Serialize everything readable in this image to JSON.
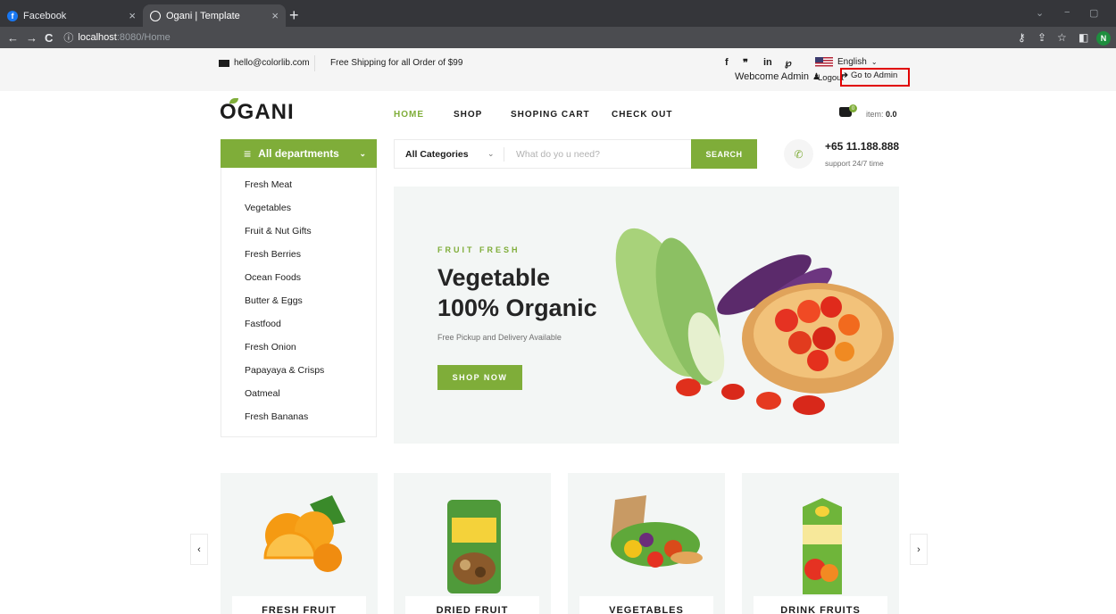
{
  "browser": {
    "tabs": [
      {
        "title": "Facebook",
        "favicon": "facebook-icon",
        "active": false
      },
      {
        "title": "Ogani | Template",
        "favicon": "globe-icon",
        "active": true
      }
    ],
    "url_host": "localhost",
    "url_path": ":8080/Home",
    "profile_initial": "N"
  },
  "topbar": {
    "email": "hello@colorlib.com",
    "shipping": "Free Shipping for all Order of $99",
    "social": [
      "f",
      "❞",
      "in",
      "℘"
    ],
    "language": "English",
    "welcome": "Webcome Admin",
    "logout": "Logout",
    "go_admin": "Go to Admin"
  },
  "header": {
    "logo": "OGANI",
    "menu": [
      "HOME",
      "SHOP",
      "SHOPING CART",
      "CHECK OUT"
    ],
    "active_menu": "HOME",
    "cart_count": "0",
    "item_label": "item:",
    "item_value": "0.0"
  },
  "departments": {
    "title": "All departments",
    "items": [
      "Fresh Meat",
      "Vegetables",
      "Fruit & Nut Gifts",
      "Fresh Berries",
      "Ocean Foods",
      "Butter & Eggs",
      "Fastfood",
      "Fresh Onion",
      "Papayaya & Crisps",
      "Oatmeal",
      "Fresh Bananas"
    ]
  },
  "search": {
    "category": "All Categories",
    "placeholder": "What do yo u need?",
    "button": "SEARCH"
  },
  "contact": {
    "phone": "+65 11.188.888",
    "support": "support 24/7 time"
  },
  "hero": {
    "subtitle": "FRUIT FRESH",
    "title_line1": "Vegetable",
    "title_line2": "100% Organic",
    "description": "Free Pickup and Delivery Available",
    "button": "SHOP NOW"
  },
  "categories": [
    "FRESH FRUIT",
    "DRIED FRUIT",
    "VEGETABLES",
    "DRINK FRUITS"
  ],
  "colors": {
    "brand_green": "#7fad39",
    "highlight_red": "#e10000"
  }
}
